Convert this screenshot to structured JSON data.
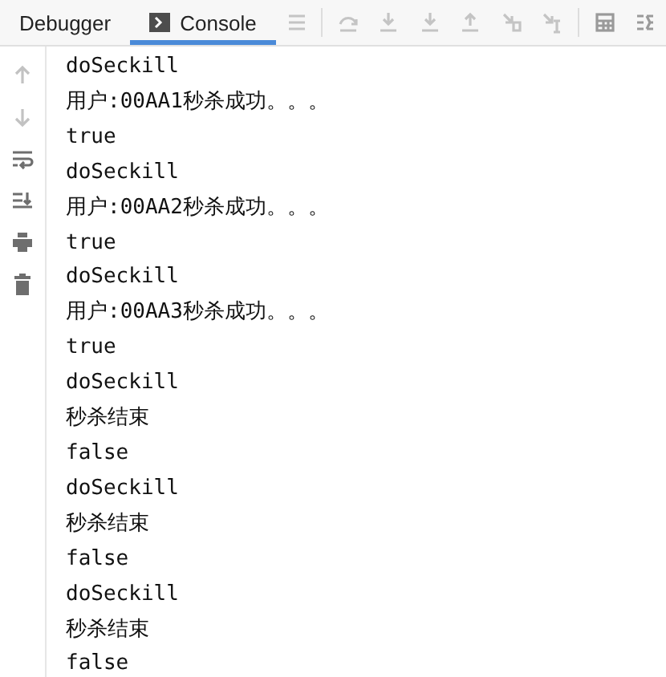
{
  "tabs": [
    {
      "label": "Debugger",
      "selected": false,
      "kind": "plain"
    },
    {
      "label": "Console",
      "selected": true,
      "kind": "console"
    }
  ],
  "toolbar": [
    {
      "kind": "menu",
      "disabled": true
    },
    {
      "kind": "step-over",
      "disabled": true
    },
    {
      "kind": "step-into",
      "disabled": true
    },
    {
      "kind": "force-step-into",
      "disabled": true
    },
    {
      "kind": "step-out",
      "disabled": true
    },
    {
      "kind": "drop-frame",
      "disabled": true
    },
    {
      "kind": "run-to-cursor",
      "disabled": true
    },
    {
      "kind": "evaluate",
      "disabled": false
    },
    {
      "kind": "trace",
      "disabled": false
    }
  ],
  "side_buttons": [
    {
      "kind": "up",
      "disabled": true
    },
    {
      "kind": "down",
      "disabled": true
    },
    {
      "kind": "wrap",
      "disabled": false
    },
    {
      "kind": "scroll-end",
      "disabled": false
    },
    {
      "kind": "print",
      "disabled": false
    },
    {
      "kind": "trash",
      "disabled": false
    }
  ],
  "console_lines": [
    "doSeckill",
    "用户:00AA1秒杀成功。。。",
    "true",
    "doSeckill",
    "用户:00AA2秒杀成功。。。",
    "true",
    "doSeckill",
    "用户:00AA3秒杀成功。。。",
    "true",
    "doSeckill",
    "秒杀结束",
    "false",
    "doSeckill",
    "秒杀结束",
    "false",
    "doSeckill",
    "秒杀结束",
    "false"
  ]
}
